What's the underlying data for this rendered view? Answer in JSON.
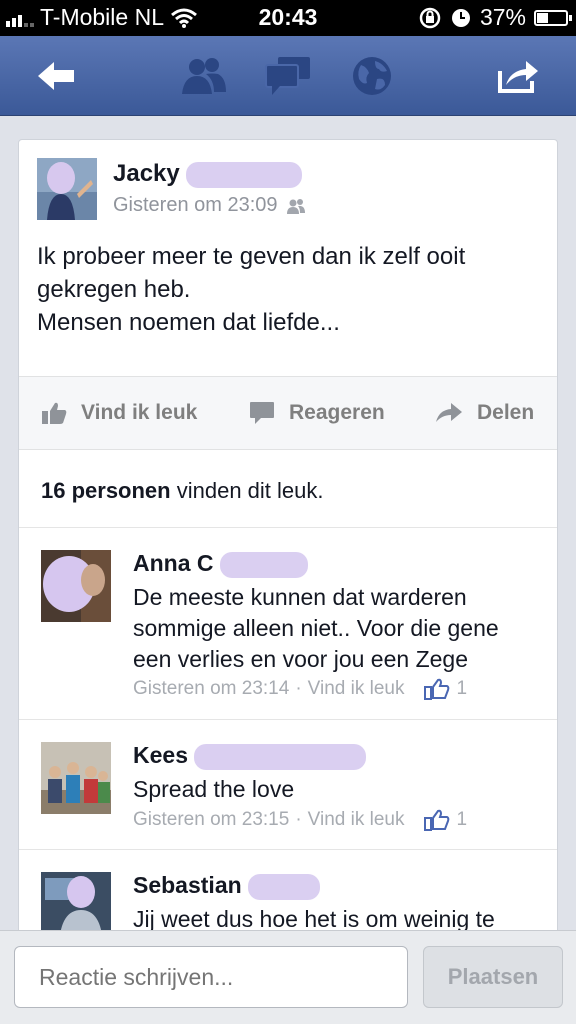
{
  "status_bar": {
    "carrier": "T-Mobile NL",
    "time": "20:43",
    "battery": "37%",
    "battery_level": 0.37
  },
  "navbar": {
    "icons": [
      "back-arrow-icon",
      "friend-requests-icon",
      "messages-icon",
      "notifications-globe-icon",
      "share-icon"
    ]
  },
  "post": {
    "author": "Jacky",
    "timestamp": "Gisteren om 23:09",
    "privacy_icon": "friends-icon",
    "text_lines": [
      "Ik probeer meer te geven dan ik zelf ooit",
      "gekregen heb.",
      "Mensen noemen dat liefde..."
    ],
    "actions": {
      "like": "Vind ik leuk",
      "comment": "Reageren",
      "share": "Delen"
    },
    "likes_count": "16 personen",
    "likes_suffix": " vinden dit leuk."
  },
  "comments": [
    {
      "name": "Anna C",
      "text_lines": [
        "De meeste kunnen dat warderen",
        "sommige alleen niet.. Voor die gene",
        "een verlies en voor jou een Zege"
      ],
      "time": "Gisteren om 23:14",
      "like_label": "Vind ik leuk",
      "like_count": "1"
    },
    {
      "name": "Kees",
      "text_lines": [
        "Spread the love"
      ],
      "time": "Gisteren om 23:15",
      "like_label": "Vind ik leuk",
      "like_count": "1"
    },
    {
      "name": "Sebastian",
      "text_lines": [
        "Jij weet dus hoe het is om weinig te"
      ],
      "time": "",
      "like_label": "",
      "like_count": ""
    }
  ],
  "composer": {
    "placeholder": "Reactie schrijven...",
    "post_label": "Plaatsen"
  },
  "colors": {
    "brand": "#3b5998",
    "redaction": "#d6caf0"
  }
}
